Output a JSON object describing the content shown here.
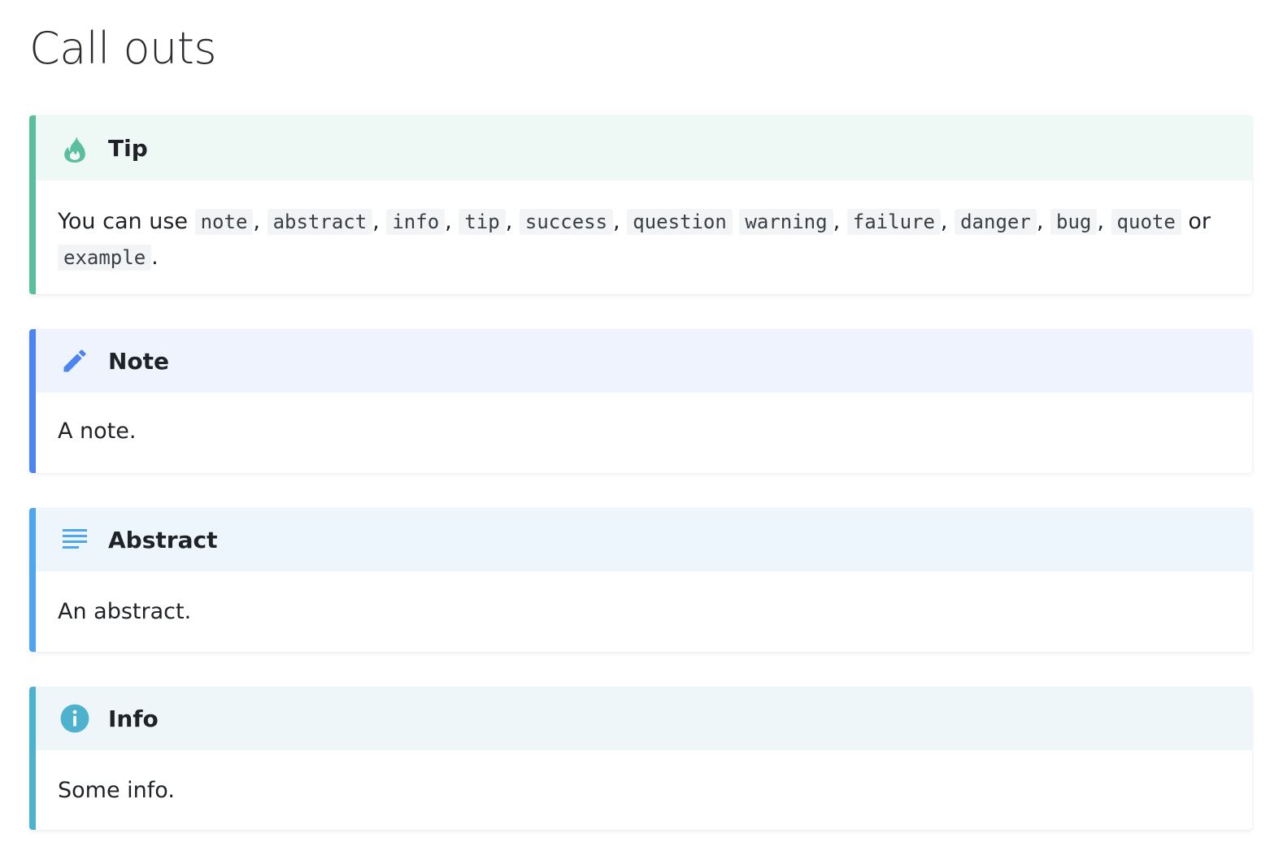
{
  "page": {
    "title": "Call outs"
  },
  "callouts": {
    "tip": {
      "title": "Tip",
      "icon": "flame-icon",
      "color": "#5bbf9f",
      "body_prefix": "You can use",
      "codes": [
        "note",
        "abstract",
        "info",
        "tip",
        "success",
        "question",
        "warning",
        "failure",
        "danger",
        "bug",
        "quote",
        "example"
      ],
      "separators": [
        ",",
        ",",
        ",",
        ",",
        ",",
        "",
        ",",
        ",",
        ",",
        ",",
        "or",
        "."
      ]
    },
    "note": {
      "title": "Note",
      "icon": "pencil-icon",
      "color": "#4c84f0",
      "body": "A note."
    },
    "abstract": {
      "title": "Abstract",
      "icon": "lines-icon",
      "color": "#4fa6ef",
      "body": "An abstract."
    },
    "info": {
      "title": "Info",
      "icon": "info-icon",
      "color": "#4eb2cf",
      "body": "Some info."
    }
  }
}
